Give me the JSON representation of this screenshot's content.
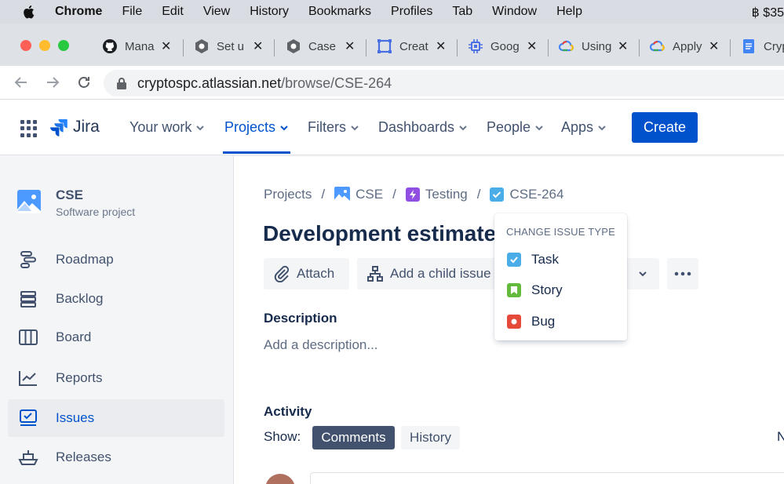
{
  "menubar": {
    "app": "Chrome",
    "items": [
      "File",
      "Edit",
      "View",
      "History",
      "Bookmarks",
      "Profiles",
      "Tab",
      "Window",
      "Help"
    ],
    "right_text": "฿ $35"
  },
  "tabs": [
    {
      "label": "Mana",
      "icon": "github-icon"
    },
    {
      "label": "Set u",
      "icon": "chromium-icon"
    },
    {
      "label": "Case",
      "icon": "chromium-icon"
    },
    {
      "label": "Creat",
      "icon": "frame-icon"
    },
    {
      "label": "Goog",
      "icon": "chip-icon"
    },
    {
      "label": "Using",
      "icon": "google-cloud-icon"
    },
    {
      "label": "Apply",
      "icon": "google-cloud-icon"
    },
    {
      "label": "Cryp",
      "icon": "docs-icon"
    }
  ],
  "address": {
    "host": "cryptospc.atlassian.net",
    "path": "/browse/CSE-264"
  },
  "jira_nav": {
    "logo": "Jira",
    "items": [
      "Your work",
      "Projects",
      "Filters",
      "Dashboards",
      "People",
      "Apps"
    ],
    "active": "Projects",
    "create_label": "Create"
  },
  "sidebar": {
    "project_name": "CSE",
    "project_type": "Software project",
    "items": [
      {
        "label": "Roadmap",
        "icon": "roadmap-icon"
      },
      {
        "label": "Backlog",
        "icon": "backlog-icon"
      },
      {
        "label": "Board",
        "icon": "board-icon"
      },
      {
        "label": "Reports",
        "icon": "reports-icon"
      },
      {
        "label": "Issues",
        "icon": "issues-icon",
        "active": true
      },
      {
        "label": "Releases",
        "icon": "releases-icon"
      }
    ]
  },
  "breadcrumb": {
    "projects": "Projects",
    "project": "CSE",
    "epic": "Testing",
    "issue": "CSE-264"
  },
  "issue": {
    "title": "Development estimates",
    "attach_label": "Attach",
    "add_child_label": "Add a child issue",
    "description_label": "Description",
    "description_placeholder": "Add a description...",
    "activity_label": "Activity",
    "show_label": "Show:",
    "filters": [
      "Comments",
      "History"
    ],
    "active_filter": "Comments",
    "edge_text": "N"
  },
  "issue_type_menu": {
    "heading": "CHANGE ISSUE TYPE",
    "options": [
      {
        "label": "Task",
        "color": "#4bade8"
      },
      {
        "label": "Story",
        "color": "#63ba3c"
      },
      {
        "label": "Bug",
        "color": "#e5493a"
      }
    ]
  },
  "colors": {
    "primary": "#0052cc",
    "sidebar_bg": "#f4f5f7"
  }
}
